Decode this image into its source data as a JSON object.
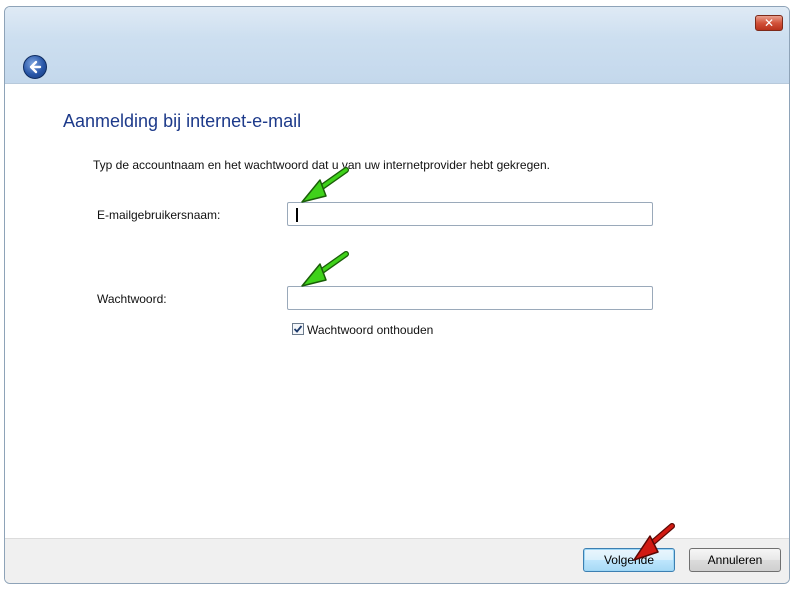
{
  "window": {
    "close_symbol": "✕"
  },
  "page": {
    "title": "Aanmelding bij internet-e-mail",
    "instruction": "Typ de accountnaam en het wachtwoord dat u van uw internetprovider hebt gekregen."
  },
  "form": {
    "username_label": "E-mailgebruikersnaam:",
    "username_value": "",
    "password_label": "Wachtwoord:",
    "password_value": "",
    "remember_label": "Wachtwoord onthouden",
    "remember_checked": true
  },
  "buttons": {
    "next_label": "Volgende",
    "cancel_label": "Annuleren"
  },
  "icons": {
    "back": "back-arrow-icon",
    "close": "close-icon",
    "annotation_green": "green-arrow",
    "annotation_red": "red-arrow"
  },
  "colors": {
    "title_blue": "#1d3a8a",
    "annotation_green": "#3fd21a",
    "annotation_red": "#d11a12"
  }
}
